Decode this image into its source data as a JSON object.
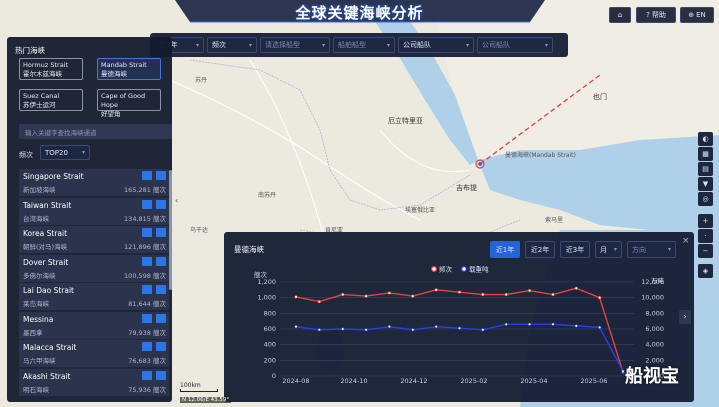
{
  "header": {
    "title": "全球关键海峡分析",
    "help_label": "帮助",
    "lang_label": "EN"
  },
  "filters": {
    "period": "近1年",
    "metric": "频次",
    "ship_type": "请选择船型",
    "ship_category": "船舶船型",
    "company": "公司船队",
    "company2": "公司船队"
  },
  "left_panel": {
    "title": "热门海峡",
    "hot": [
      {
        "en": "Hormuz Strait",
        "zh": "霍尔木兹海峡"
      },
      {
        "en": "Mandab Strait",
        "zh": "曼德海峡"
      },
      {
        "en": "Suez Canal",
        "zh": "苏伊士运河"
      },
      {
        "en": "Cape of Good Hope",
        "zh": "好望角"
      }
    ],
    "search_placeholder": "输入关键字查找海峡通道",
    "freq_label": "频次",
    "top_select": "TOP20",
    "rows": [
      {
        "en": "Singapore Strait",
        "zh": "新加坡海峡",
        "value": "165,281 艘次"
      },
      {
        "en": "Taiwan Strait",
        "zh": "台湾海峡",
        "value": "134,815 艘次"
      },
      {
        "en": "Korea Strait",
        "zh": "朝鲜(对马)海峡",
        "value": "121,896 艘次"
      },
      {
        "en": "Dover Strait",
        "zh": "多佛尔海峡",
        "value": "100,598 艘次"
      },
      {
        "en": "Lai Dao Strait",
        "zh": "莱岛海峡",
        "value": "81,644 艘次"
      },
      {
        "en": "Messina",
        "zh": "墨西拿",
        "value": "79,938 艘次"
      },
      {
        "en": "Malacca Strait",
        "zh": "马六甲海峡",
        "value": "76,683 艘次"
      },
      {
        "en": "Akashi Strait",
        "zh": "明石海峡",
        "value": "75,936 艘次"
      }
    ]
  },
  "map": {
    "labels": {
      "eritrea": "厄立特里亚",
      "djibouti": "吉布提",
      "yemen": "也门",
      "mandab_label": "曼德海峡(Mandab Strait)",
      "sudan": "苏丹",
      "ethiopia": "埃塞俄比亚",
      "somalia": "索马里",
      "south_sudan": "南苏丹",
      "kenya": "肯尼亚",
      "uganda": "乌干达"
    },
    "scale": "100km",
    "coords": "N 12.06/E 43.59°"
  },
  "chart_panel": {
    "title": "曼德海峡",
    "buttons": [
      "近1年",
      "近2年",
      "近3年"
    ],
    "granularity": "月",
    "direction": "方向"
  },
  "chart_data": {
    "type": "line",
    "x": [
      "2024-08",
      "2024-10",
      "2024-12",
      "2025-02",
      "2025-04",
      "2025-06"
    ],
    "legend": [
      "频次",
      "载重吨"
    ],
    "left_unit": "艘次",
    "right_unit": "万吨",
    "left_ticks": [
      "1,200",
      "1,000",
      "800",
      "600",
      "400",
      "200",
      "0"
    ],
    "right_ticks": [
      "12,000",
      "10,000",
      "8,000",
      "6,000",
      "4,000",
      "2,000",
      "0"
    ],
    "ylim_left": [
      0,
      1200
    ],
    "ylim_right": [
      0,
      12000
    ],
    "series": [
      {
        "name": "频次",
        "axis": "left",
        "color": "#e8423b",
        "values": [
          1010,
          950,
          1040,
          1020,
          1060,
          1020,
          1100,
          1070,
          1040,
          1040,
          1090,
          1040,
          1120,
          1000,
          50
        ]
      },
      {
        "name": "载重吨",
        "axis": "right",
        "color": "#2b3ee6",
        "values": [
          6300,
          5900,
          6000,
          5900,
          6300,
          5900,
          6300,
          6100,
          5900,
          6600,
          6600,
          6600,
          6400,
          6200,
          600
        ]
      }
    ]
  },
  "watermark": "船视宝",
  "colors": {
    "accent": "#2563d8",
    "panel_bg": "#16203a",
    "line_freq": "#e8423b",
    "line_dwt": "#2b3ee6"
  }
}
